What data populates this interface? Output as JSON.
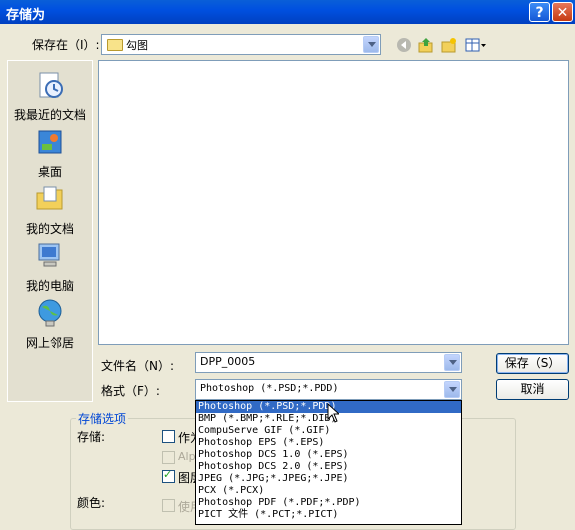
{
  "window": {
    "title": "存储为"
  },
  "top": {
    "save_in_label": "保存在（I）:",
    "folder": "勾图"
  },
  "places": [
    {
      "label": "我最近的文档",
      "icon": "recent-documents-icon"
    },
    {
      "label": "桌面",
      "icon": "desktop-icon"
    },
    {
      "label": "我的文档",
      "icon": "my-documents-icon"
    },
    {
      "label": "我的电脑",
      "icon": "my-computer-icon"
    },
    {
      "label": "网上邻居",
      "icon": "network-places-icon"
    }
  ],
  "filename": {
    "label": "文件名（N）:",
    "value": "DPP_0005"
  },
  "format": {
    "label": "格式（F）:",
    "value": "Photoshop (*.PSD;*.PDD)",
    "options": [
      "Photoshop (*.PSD;*.PDD)",
      "BMP (*.BMP;*.RLE;*.DIB)",
      "CompuServe GIF (*.GIF)",
      "Photoshop EPS (*.EPS)",
      "Photoshop DCS 1.0 (*.EPS)",
      "Photoshop DCS 2.0 (*.EPS)",
      "JPEG (*.JPG;*.JPEG;*.JPE)",
      "PCX (*.PCX)",
      "Photoshop PDF (*.PDF;*.PDP)",
      "PICT 文件 (*.PCT;*.PICT)"
    ],
    "selected_index": 0
  },
  "buttons": {
    "save": "保存（S）",
    "cancel": "取消"
  },
  "options": {
    "title": "存储选项",
    "storage_label": "存储:",
    "as_copy": "作为",
    "alpha": "Alp",
    "layers": "图层",
    "color_label": "颜色:",
    "use": "使用"
  }
}
